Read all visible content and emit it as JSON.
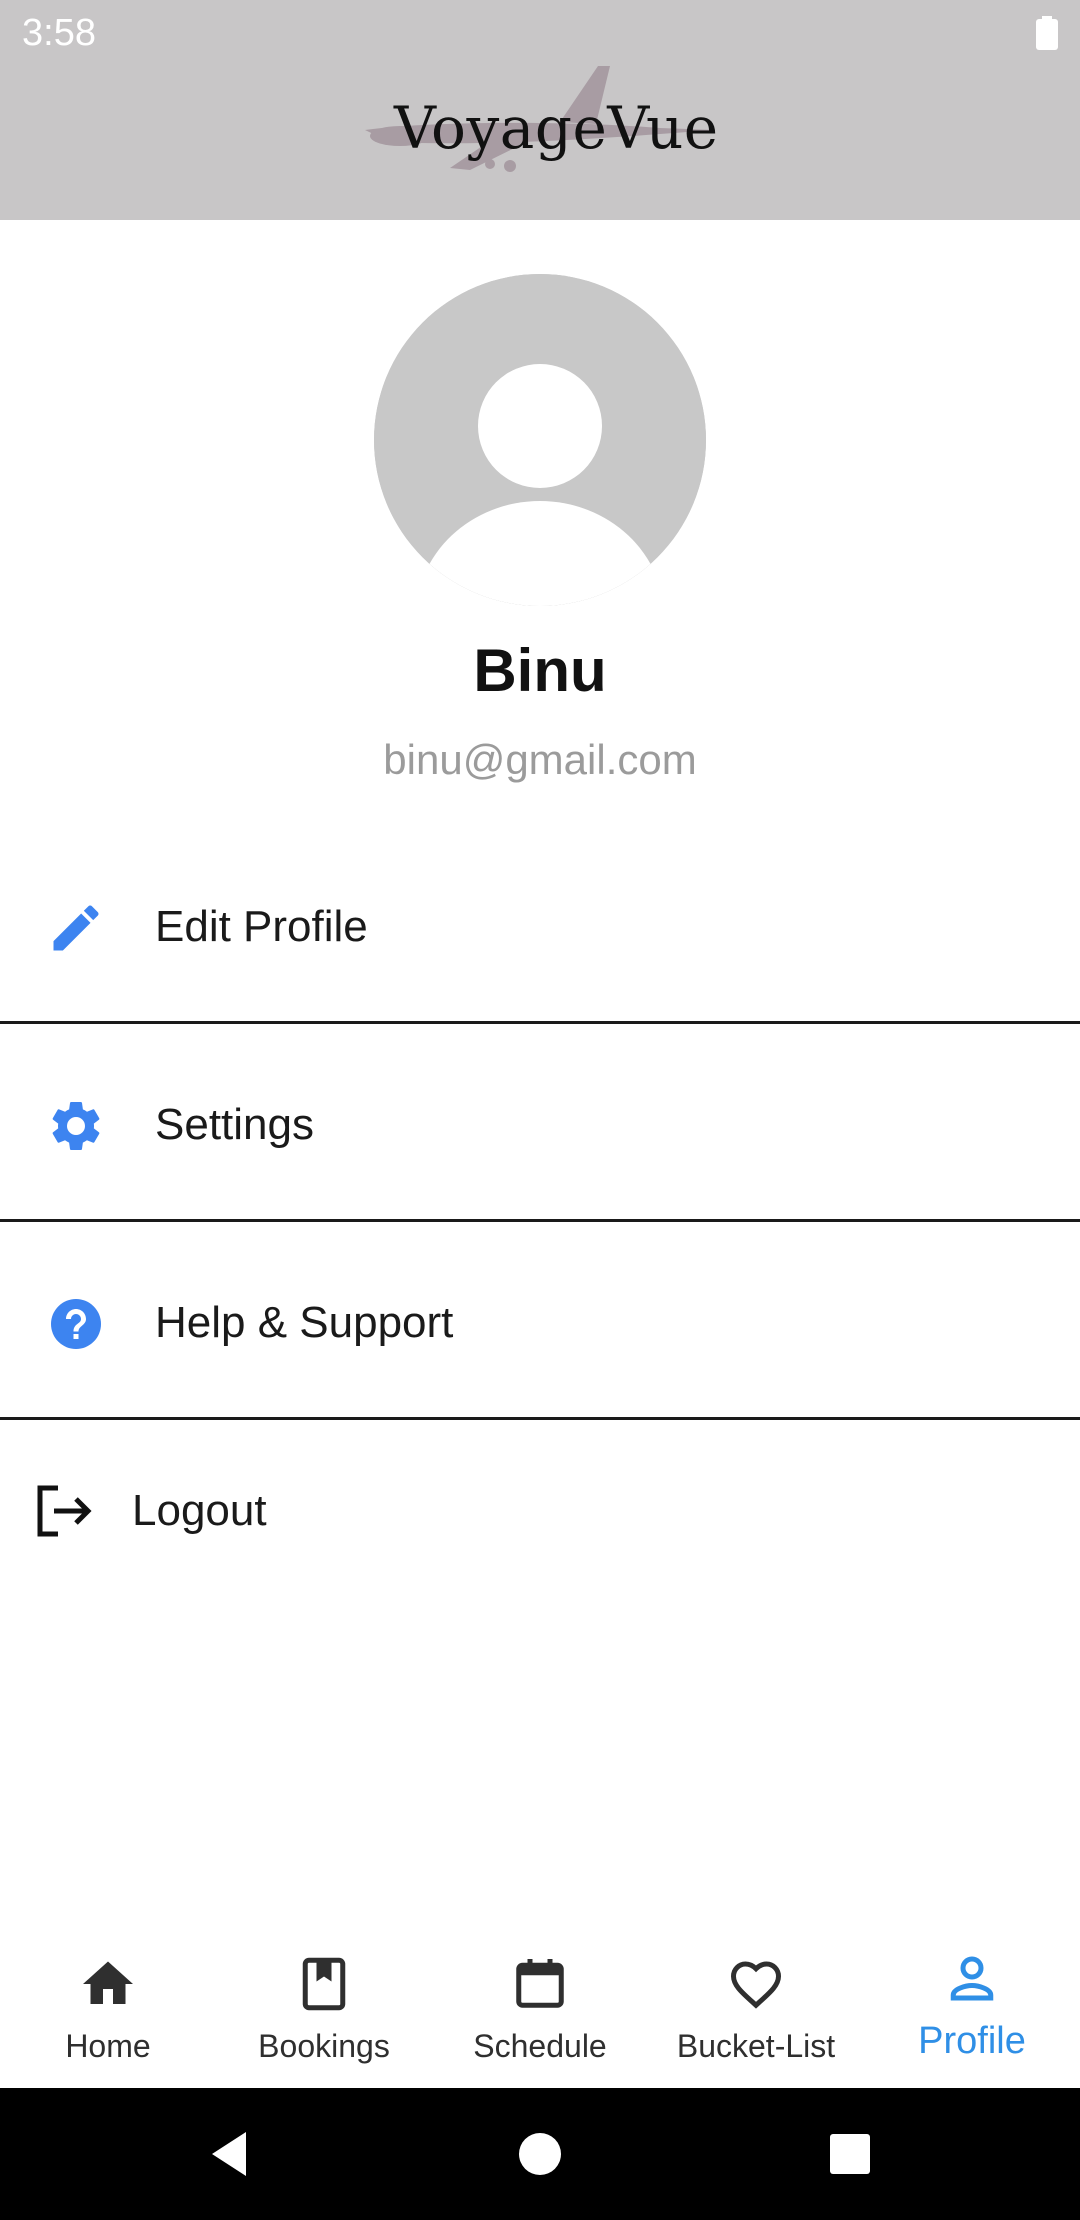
{
  "status_bar": {
    "time": "3:58"
  },
  "app": {
    "logo_text": "VoyageVue"
  },
  "profile": {
    "name": "Binu",
    "email": "binu@gmail.com"
  },
  "menu": [
    {
      "label": "Edit Profile",
      "icon": "pencil-icon"
    },
    {
      "label": "Settings",
      "icon": "gear-icon"
    },
    {
      "label": "Help & Support",
      "icon": "help-circle-icon"
    },
    {
      "label": "Logout",
      "icon": "logout-icon"
    }
  ],
  "bottom_nav": [
    {
      "label": "Home",
      "icon": "home-icon"
    },
    {
      "label": "Bookings",
      "icon": "bookmark-book-icon"
    },
    {
      "label": "Schedule",
      "icon": "calendar-icon"
    },
    {
      "label": "Bucket-List",
      "icon": "heart-icon"
    },
    {
      "label": "Profile",
      "icon": "person-icon",
      "active": true
    }
  ],
  "colors": {
    "header_bg": "#c8c6c7",
    "accent_blue": "#3d84f0",
    "nav_active": "#2f8fe6",
    "text_dark": "#1a1a1a",
    "email_gray": "#9b9b9b"
  }
}
